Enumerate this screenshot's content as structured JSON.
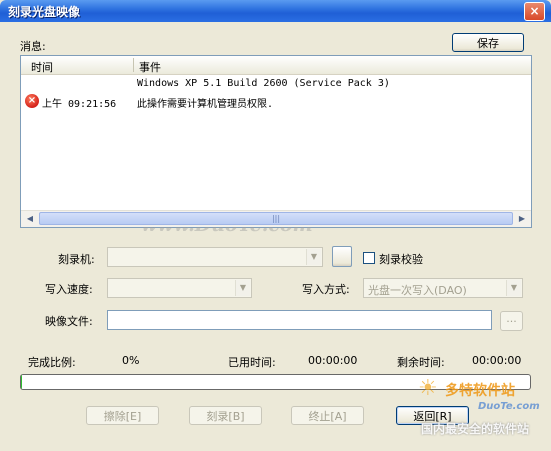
{
  "window": {
    "title": "刻录光盘映像",
    "close_symbol": "×"
  },
  "messages": {
    "label": "消息:",
    "save_button": "保存",
    "columns": [
      "时间",
      "事件"
    ],
    "rows": [
      {
        "time": "",
        "event": "Windows XP 5.1 Build 2600 (Service Pack 3)"
      },
      {
        "time": "上午 09:21:56",
        "event": "此操作需要计算机管理员权限.",
        "icon": "error-icon"
      }
    ],
    "scroll": {
      "left": "◀",
      "right": "▶",
      "grip": "|||"
    }
  },
  "form": {
    "burner_label": "刻录机:",
    "burner_value": "",
    "verify_label": "刻录校验",
    "write_speed_label": "写入速度:",
    "write_speed_value": "",
    "write_mode_label": "写入方式:",
    "write_mode_value": "光盘一次写入(DAO)",
    "image_file_label": "映像文件:",
    "image_file_value": "",
    "browse_label": "...",
    "combo_arrow": "▼"
  },
  "status": {
    "completed_label": "完成比例:",
    "completed_value": "0%",
    "elapsed_label": "已用时间:",
    "elapsed_value": "00:00:00",
    "remaining_label": "剩余时间:",
    "remaining_value": "00:00:00",
    "progress": 0.002
  },
  "buttons": {
    "erase": "擦除[E]",
    "burn": "刻录[B]",
    "stop": "终止[A]",
    "back": "返回[R]"
  },
  "watermark": {
    "center": "www.DuoTe.com",
    "corner_brand": "多特软件站",
    "corner_url": "DuoTe.com",
    "corner_slogan": "国内最安全的软件站"
  },
  "colors": {
    "title_bar": "#2f73e0",
    "progress_fill": "#2fbf2f",
    "error_icon": "#d4221b",
    "face": "#ece9d8"
  }
}
